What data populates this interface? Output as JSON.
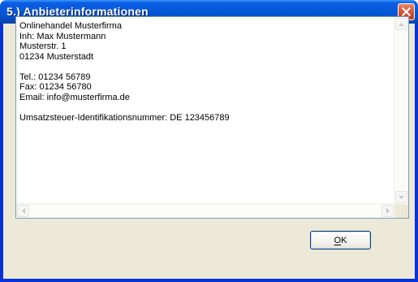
{
  "dialog": {
    "title": "5.) Anbieterinformationen",
    "close_icon": "close-icon"
  },
  "info_text": "Onlinehandel Musterfirma\nInh: Max Mustermann\nMusterstr. 1\n01234 Musterstadt\n\nTel.: 01234 56789\nFax: 01234 56780\nEmail: info@musterfirma.de\n\nUmsatzsteuer-Identifikationsnummer: DE 123456789",
  "ok_button": {
    "label": "OK"
  },
  "colors": {
    "titlebar": "#0a5ee3",
    "close_button": "#d65b3a",
    "dialog_face": "#ece9d8"
  }
}
